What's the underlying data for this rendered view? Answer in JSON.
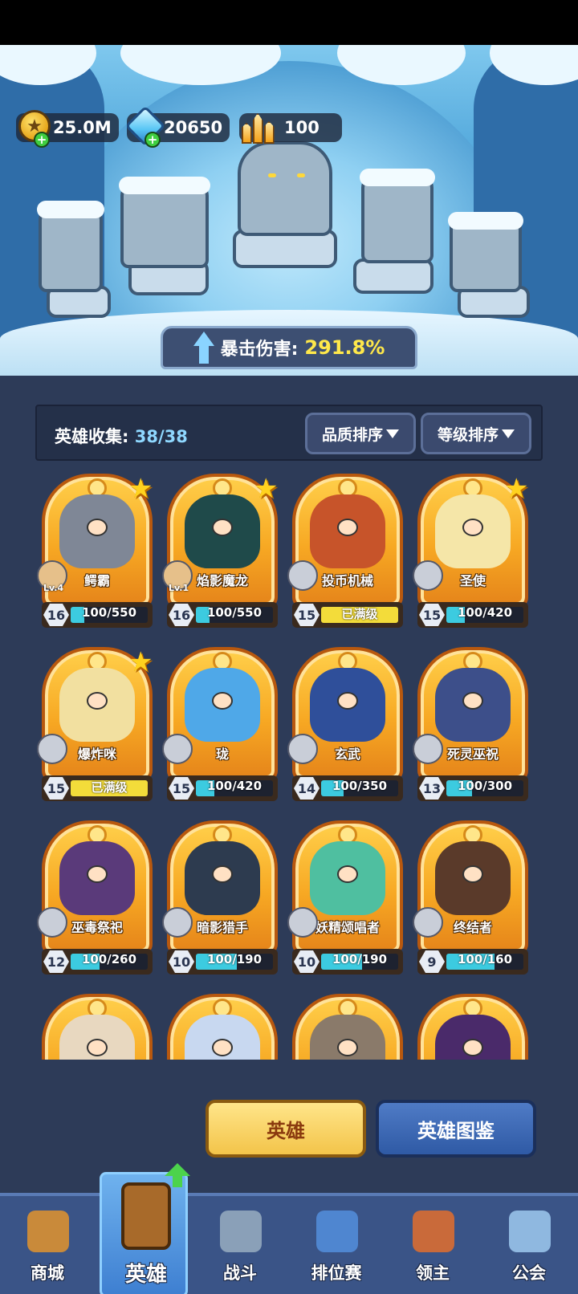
{
  "currencies": [
    {
      "name": "coin",
      "icon": "gold-coin-icon",
      "value": "25.0M",
      "has_plus": true
    },
    {
      "name": "gem",
      "icon": "blue-gem-icon",
      "value": "20650",
      "has_plus": true
    },
    {
      "name": "crystal",
      "icon": "gold-crystal-icon",
      "value": "100",
      "has_plus": false
    }
  ],
  "crit": {
    "label": "暴击伤害:",
    "value": "291.8%"
  },
  "collection": {
    "label": "英雄收集:",
    "value": "38/38"
  },
  "sort": {
    "quality_label": "品质排序",
    "level_label": "等级排序"
  },
  "heroes": [
    {
      "name": "鳄霸",
      "level": "16",
      "progress": "100/550",
      "fill": 0.18,
      "maxed": false,
      "star": true,
      "lv_tag": "Lv.4",
      "art": "#7f8796"
    },
    {
      "name": "焰影魔龙",
      "level": "16",
      "progress": "100/550",
      "fill": 0.18,
      "maxed": false,
      "star": true,
      "lv_tag": "Lv.1",
      "art": "#1f4a4a"
    },
    {
      "name": "投币机械",
      "level": "15",
      "progress": "已满级",
      "fill": 1,
      "maxed": true,
      "star": false,
      "lv_tag": "",
      "art": "#c7542a"
    },
    {
      "name": "圣使",
      "level": "15",
      "progress": "100/420",
      "fill": 0.24,
      "maxed": false,
      "star": true,
      "lv_tag": "",
      "art": "#f5e6a8"
    },
    {
      "name": "爆炸咪",
      "level": "15",
      "progress": "已满级",
      "fill": 1,
      "maxed": true,
      "star": true,
      "lv_tag": "",
      "art": "#f2e0a0"
    },
    {
      "name": "珑",
      "level": "15",
      "progress": "100/420",
      "fill": 0.24,
      "maxed": false,
      "star": false,
      "lv_tag": "",
      "art": "#4fa8e8"
    },
    {
      "name": "玄武",
      "level": "14",
      "progress": "100/350",
      "fill": 0.29,
      "maxed": false,
      "star": false,
      "lv_tag": "",
      "art": "#2f4f9a"
    },
    {
      "name": "死灵巫祝",
      "level": "13",
      "progress": "100/300",
      "fill": 0.33,
      "maxed": false,
      "star": false,
      "lv_tag": "",
      "art": "#3d4f8a"
    },
    {
      "name": "巫毒祭祀",
      "level": "12",
      "progress": "100/260",
      "fill": 0.38,
      "maxed": false,
      "star": false,
      "lv_tag": "",
      "art": "#5a3a7a"
    },
    {
      "name": "暗影猎手",
      "level": "10",
      "progress": "100/190",
      "fill": 0.53,
      "maxed": false,
      "star": false,
      "lv_tag": "",
      "art": "#2d3b4f"
    },
    {
      "name": "妖精颂唱者",
      "level": "10",
      "progress": "100/190",
      "fill": 0.53,
      "maxed": false,
      "star": false,
      "lv_tag": "",
      "art": "#4fbfa0"
    },
    {
      "name": "终结者",
      "level": "9",
      "progress": "100/160",
      "fill": 0.63,
      "maxed": false,
      "star": false,
      "lv_tag": "",
      "art": "#5a3a2a"
    },
    {
      "name": "",
      "level": "",
      "progress": "",
      "fill": 0,
      "maxed": false,
      "star": false,
      "lv_tag": "",
      "art": "#e8d8c0"
    },
    {
      "name": "",
      "level": "",
      "progress": "",
      "fill": 0,
      "maxed": false,
      "star": false,
      "lv_tag": "",
      "art": "#c8d8f0"
    },
    {
      "name": "",
      "level": "",
      "progress": "",
      "fill": 0,
      "maxed": false,
      "star": false,
      "lv_tag": "",
      "art": "#8a7a6a"
    },
    {
      "name": "",
      "level": "",
      "progress": "",
      "fill": 0,
      "maxed": false,
      "star": false,
      "lv_tag": "",
      "art": "#4a2a6a"
    }
  ],
  "buttons": {
    "hero": "英雄",
    "atlas": "英雄图鉴"
  },
  "nav": [
    {
      "label": "商城",
      "icon": "shop-chest-icon",
      "active": false
    },
    {
      "label": "英雄",
      "icon": "hero-card-icon",
      "active": true
    },
    {
      "label": "战斗",
      "icon": "crossed-swords-icon",
      "active": false
    },
    {
      "label": "排位赛",
      "icon": "ranked-shield-icon",
      "active": false
    },
    {
      "label": "领主",
      "icon": "lord-banner-icon",
      "active": false
    },
    {
      "label": "公会",
      "icon": "guild-castle-icon",
      "active": false
    }
  ],
  "colors": {
    "accent_gold": "#f7a823",
    "panel": "#2d3b58",
    "nav": "#3a5487",
    "crit_value": "#ffe84a"
  }
}
